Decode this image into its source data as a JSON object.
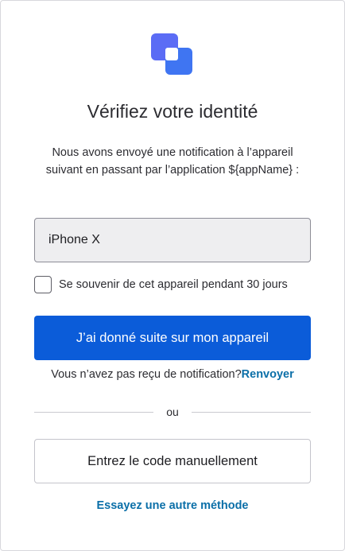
{
  "logo": {
    "icon": "app-logo-icon",
    "colors": {
      "back": "#5b6cf5",
      "front": "#3f75f2",
      "overlap": "#ffffff"
    }
  },
  "title": "Vérifiez votre identité",
  "description": "Nous avons envoyé une notification à l’appareil suivant en passant par l’application ${appName} :",
  "device_field": {
    "value": "iPhone X"
  },
  "remember": {
    "label": "Se souvenir de cet appareil pendant 30 jours",
    "checked": false
  },
  "primary_button": {
    "label": "J’ai donné suite sur mon appareil",
    "color": "#0b5cd9"
  },
  "resend": {
    "text": "Vous n’avez pas reçu de notification?",
    "link": "Renvoyer"
  },
  "divider": {
    "label": "ou"
  },
  "manual_code_button": {
    "label": "Entrez le code manuellement"
  },
  "other_method_link": "Essayez une autre méthode",
  "accent_link_color": "#0b6fa8"
}
